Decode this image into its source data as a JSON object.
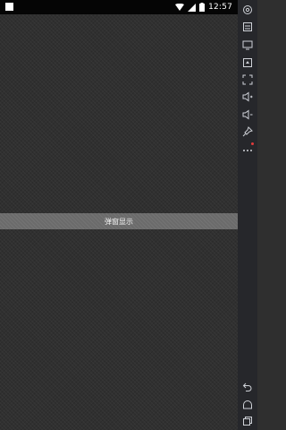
{
  "status_bar": {
    "time": "12:57",
    "icons": [
      "notification-square-icon",
      "wifi-icon",
      "signal-icon",
      "battery-icon"
    ]
  },
  "main": {
    "popup_button_label": "弹窗显示"
  },
  "sidebar": {
    "icons": [
      "settings-icon",
      "keyboard-icon",
      "screen-icon",
      "screenshot-icon",
      "fullscreen-icon",
      "volume-up-icon",
      "volume-down-icon",
      "pin-icon",
      "more-icon",
      "back-icon",
      "home-icon",
      "recents-icon"
    ]
  },
  "colors": {
    "background": "#303030",
    "status_bar": "#050505",
    "button": "#6b6b6b",
    "sidebar": "#26272b",
    "alert_dot": "#e23b3b"
  }
}
